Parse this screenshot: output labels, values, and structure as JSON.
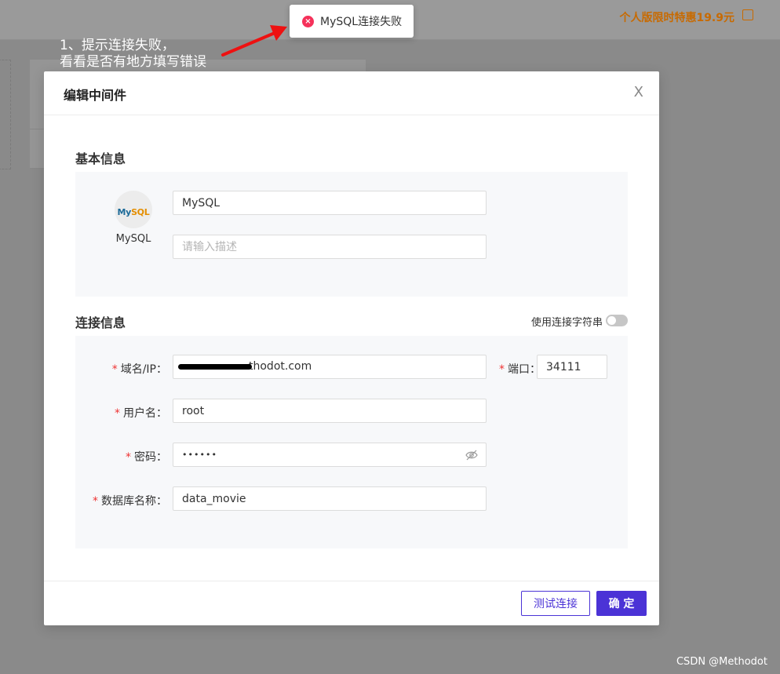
{
  "background": {
    "promo_text": "个人版限时特惠19.9元"
  },
  "annotation": {
    "line1": "1、提示连接失败，",
    "line2": "看看是否有地方填写错误"
  },
  "toast": {
    "message": "MySQL连接失败"
  },
  "modal": {
    "title": "编辑中间件",
    "close_label": "X",
    "basic_section": {
      "title": "基本信息",
      "logo_caption": "MySQL",
      "logo_text_main": "My",
      "logo_text_accent": "SQL",
      "name_value": "MySQL",
      "description_placeholder": "请输入描述"
    },
    "connection_section": {
      "title": "连接信息",
      "toggle_label": "使用连接字符串",
      "host_label": "域名/IP：",
      "host_value": "thodot.com",
      "port_label": "端口：",
      "port_value": "34111",
      "username_label": "用户名：",
      "username_value": "root",
      "password_label": "密码：",
      "password_value": "••••••",
      "database_label": "数据库名称：",
      "database_value": "data_movie",
      "required_mark": "*"
    },
    "footer": {
      "test_button": "测试连接",
      "confirm_button": "确 定"
    }
  },
  "watermark": "CSDN @Methodot",
  "colors": {
    "primary": "#4b33d6",
    "error": "#f5315a",
    "required": "#ee3333",
    "promo": "#c86a00"
  }
}
